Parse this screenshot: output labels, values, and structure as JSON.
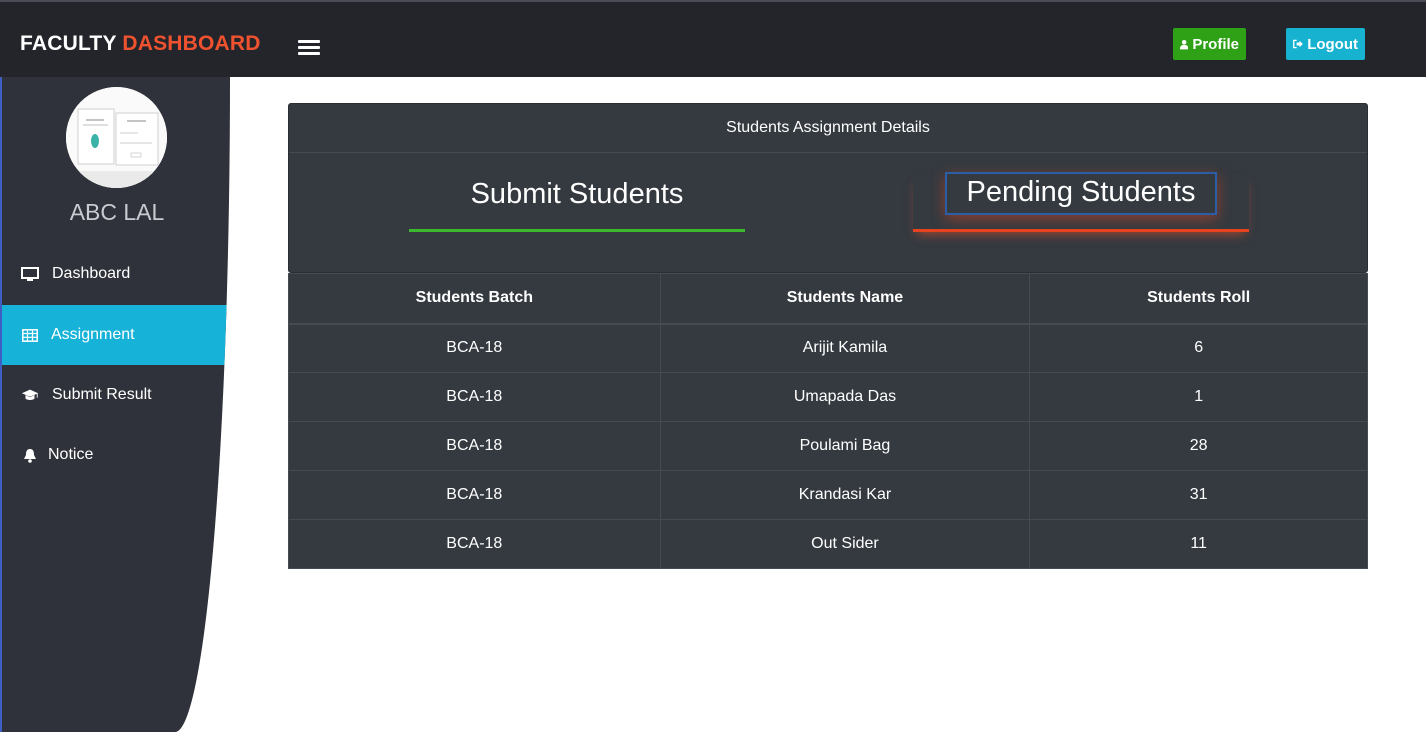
{
  "header": {
    "brand_primary": "FACULTY",
    "brand_accent": "DASHBOARD",
    "profile_label": "Profile",
    "logout_label": "Logout"
  },
  "sidebar": {
    "user_name": "ABC LAL",
    "items": [
      {
        "label": "Dashboard",
        "icon": "monitor-icon",
        "active": false
      },
      {
        "label": "Assignment",
        "icon": "table-icon",
        "active": true
      },
      {
        "label": "Submit Result",
        "icon": "graduation-cap-icon",
        "active": false
      },
      {
        "label": "Notice",
        "icon": "bell-icon",
        "active": false
      }
    ]
  },
  "card": {
    "title": "Students Assignment Details",
    "tabs": [
      {
        "label": "Submit Students"
      },
      {
        "label": "Pending Students"
      }
    ]
  },
  "table": {
    "headers": [
      "Students Batch",
      "Students Name",
      "Students Roll"
    ],
    "rows": [
      [
        "BCA-18",
        "Arijit Kamila",
        "6"
      ],
      [
        "BCA-18",
        "Umapada Das",
        "1"
      ],
      [
        "BCA-18",
        "Poulami Bag",
        "28"
      ],
      [
        "BCA-18",
        "Krandasi Kar",
        "31"
      ],
      [
        "BCA-18",
        "Out Sider",
        "11"
      ]
    ]
  },
  "colors": {
    "accent": "#f0522f",
    "profile_button": "#2ea116",
    "logout_button": "#17b2cf",
    "active_nav": "#17b2d7"
  }
}
